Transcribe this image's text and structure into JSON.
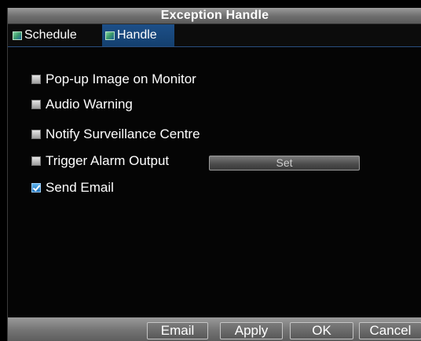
{
  "window": {
    "title": "Exception Handle"
  },
  "tabs": [
    {
      "label": "Schedule",
      "active": false
    },
    {
      "label": "Handle",
      "active": true
    }
  ],
  "options": [
    {
      "label": "Pop-up Image on Monitor",
      "checked": false
    },
    {
      "label": "Audio Warning",
      "checked": false
    },
    {
      "label": "Notify Surveillance Centre",
      "checked": false
    },
    {
      "label": "Trigger Alarm Output",
      "checked": false
    },
    {
      "label": "Send Email",
      "checked": true
    }
  ],
  "set_button": {
    "label": "Set"
  },
  "footer": {
    "email_label": "Email",
    "apply_label": "Apply",
    "ok_label": "OK",
    "cancel_label": "Cancel"
  },
  "colors": {
    "title_bar": "#7a7a7a",
    "active_tab": "#1d4f88",
    "checkbox_checked": "#2a88d8"
  }
}
